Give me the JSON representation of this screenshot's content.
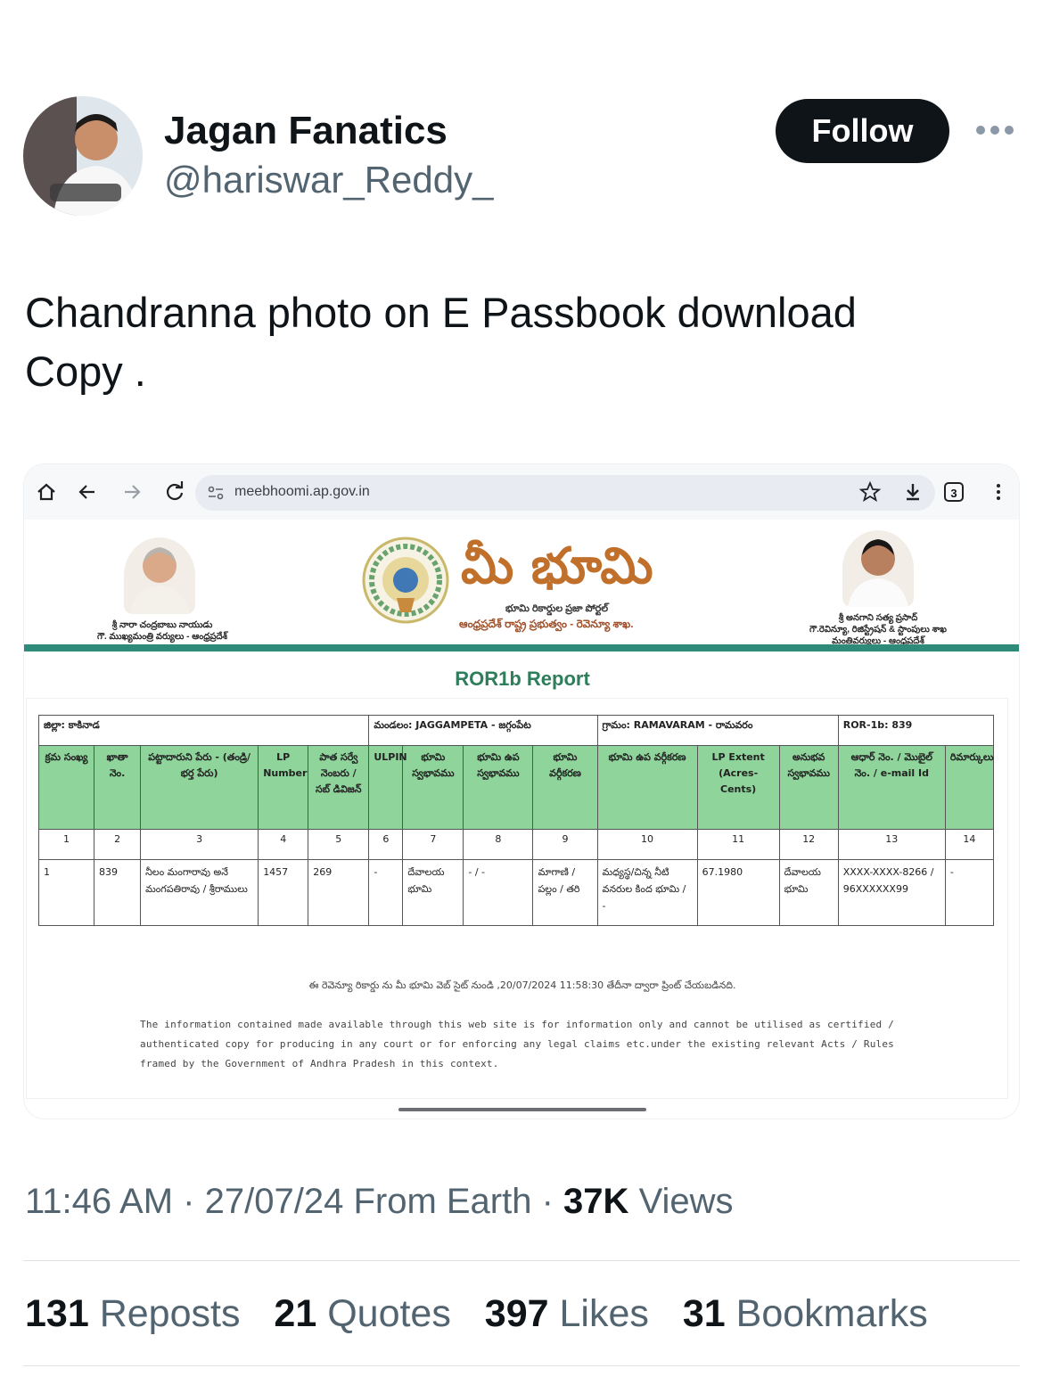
{
  "tweet": {
    "display_name": "Jagan Fanatics",
    "handle": "@hariswar_Reddy_",
    "follow_label": "Follow",
    "text_line1": "Chandranna photo on E Passbook download",
    "text_line2": "Copy .",
    "time": "11:46 AM",
    "date": "27/07/24",
    "source": "From Earth",
    "views_count": "37K",
    "views_label": "Views",
    "reposts_count": "131",
    "reposts_label": "Reposts",
    "quotes_count": "21",
    "quotes_label": "Quotes",
    "likes_count": "397",
    "likes_label": "Likes",
    "bookmarks_count": "31",
    "bookmarks_label": "Bookmarks"
  },
  "browser": {
    "url": "meebhoomi.ap.gov.in",
    "tab_count": "3",
    "icons": [
      "home-icon",
      "back-icon",
      "forward-icon",
      "reload-icon",
      "site-settings-icon",
      "star-icon",
      "download-icon",
      "tabs-icon",
      "menu-icon"
    ]
  },
  "site": {
    "title": "మీ భూమి",
    "subtitle1": "భూమి రికార్డుల ప్రజా పోర్టల్",
    "subtitle2": "ఆంధ్రప్రదేశ్ రాష్ట్ర ప్రభుత్వం - రెవెన్యూ శాఖ.",
    "left_caption_line1": "శ్రీ నారా చంద్రబాబు నాయుడు",
    "left_caption_line2": "గౌ. ముఖ్యమంత్రి వర్యులు - ఆంధ్రప్రదేశ్",
    "right_caption_line1": "శ్రీ అనగాని సత్య ప్రసాద్",
    "right_caption_line2": "గౌ.రెవిన్యూ, రిజిస్ట్రేషన్ & స్టాంపులు శాఖ",
    "right_caption_line3": "మంత్రివర్యులు - ఆంధ్రప్రదేశ్"
  },
  "report": {
    "title": "ROR1b Report",
    "district": "జిల్లా: కాకినాడ",
    "mandal": "మండలం: JAGGAMPETA - జగ్గంపేట",
    "village": "గ్రామం: RAMAVARAM - రామవరం",
    "ror": "ROR-1b: 839",
    "headers": [
      "క్రమ సంఖ్య",
      "ఖాతా నెం.",
      "పట్టాదారుని పేరు - (తండ్రి/భర్త పేరు)",
      "LP Number",
      "పాత సర్వే నెంబరు / సబ్ డివిజన్",
      "ULPIN",
      "భూమి స్వభావము",
      "భూమి ఉప స్వభావము",
      "భూమి వర్గీకరణ",
      "భూమి ఉప వర్గీకరణ",
      "LP Extent (Acres-Cents)",
      "అనుభవ స్వభావము",
      "ఆధార్ నెం. / మొబైల్ నెం. / e-mail Id",
      "రిమార్కులు"
    ],
    "column_numbers": [
      "1",
      "2",
      "3",
      "4",
      "5",
      "6",
      "7",
      "8",
      "9",
      "10",
      "11",
      "12",
      "13",
      "14"
    ],
    "row": [
      "1",
      "839",
      "నీలం మంగారావు అనే మంగపతిరావు / శ్రీరాములు",
      "1457",
      "269",
      "-",
      "దేవాలయ భూమి",
      "- / -",
      "మాగాణి / పల్లం / తరి",
      "మధ్యస్థ/చిన్న నీటి వనరుల కింద భూమి / -",
      "67.1980",
      "దేవాలయ భూమి",
      "XXXX-XXXX-8266 / 96XXXXXX99",
      "-"
    ],
    "print_note": "ఈ రెవెన్యూ రికార్డు ను మీ భూమి వెబ్ సైట్ నుండి ,20/07/2024 11:58:30 తేదీనా ద్వారా ప్రింట్ చేయబడినది.",
    "disclaimer": "The information contained made available through this web site is for information only and cannot be utilised as certified / authenticated copy for producing in any court or for enforcing any legal claims etc.under the existing relevant Acts / Rules framed by the Government of Andhra Pradesh in this context."
  }
}
